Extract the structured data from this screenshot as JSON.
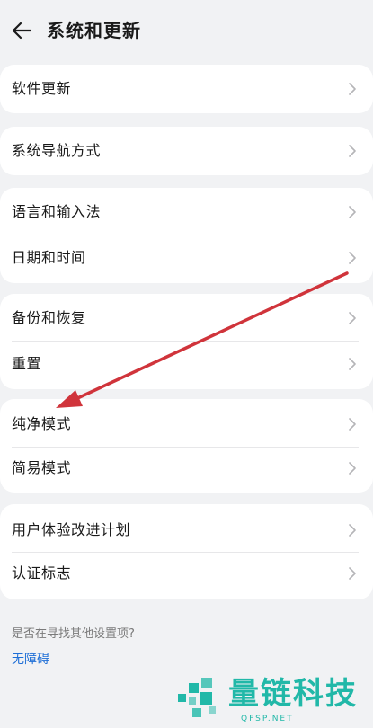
{
  "header": {
    "title": "系统和更新"
  },
  "items": [
    {
      "label": "软件更新"
    },
    {
      "label": "系统导航方式"
    },
    {
      "label": "语言和输入法"
    },
    {
      "label": "日期和时间"
    },
    {
      "label": "备份和恢复"
    },
    {
      "label": "重置"
    },
    {
      "label": "纯净模式"
    },
    {
      "label": "简易模式"
    },
    {
      "label": "用户体验改进计划"
    },
    {
      "label": "认证标志"
    }
  ],
  "footer": {
    "question": "是否在寻找其他设置项?",
    "link": "无障碍"
  },
  "watermark": {
    "brand": "量链科技",
    "domain": "QFSP.NET"
  },
  "colors": {
    "background": "#f1f2f4",
    "card": "#ffffff",
    "link": "#1f6fd6",
    "annotation_arrow": "#d0343b",
    "watermark": "#21b8a8"
  },
  "icons": {
    "back": "arrow-left-icon",
    "row": "chevron-right-icon"
  }
}
